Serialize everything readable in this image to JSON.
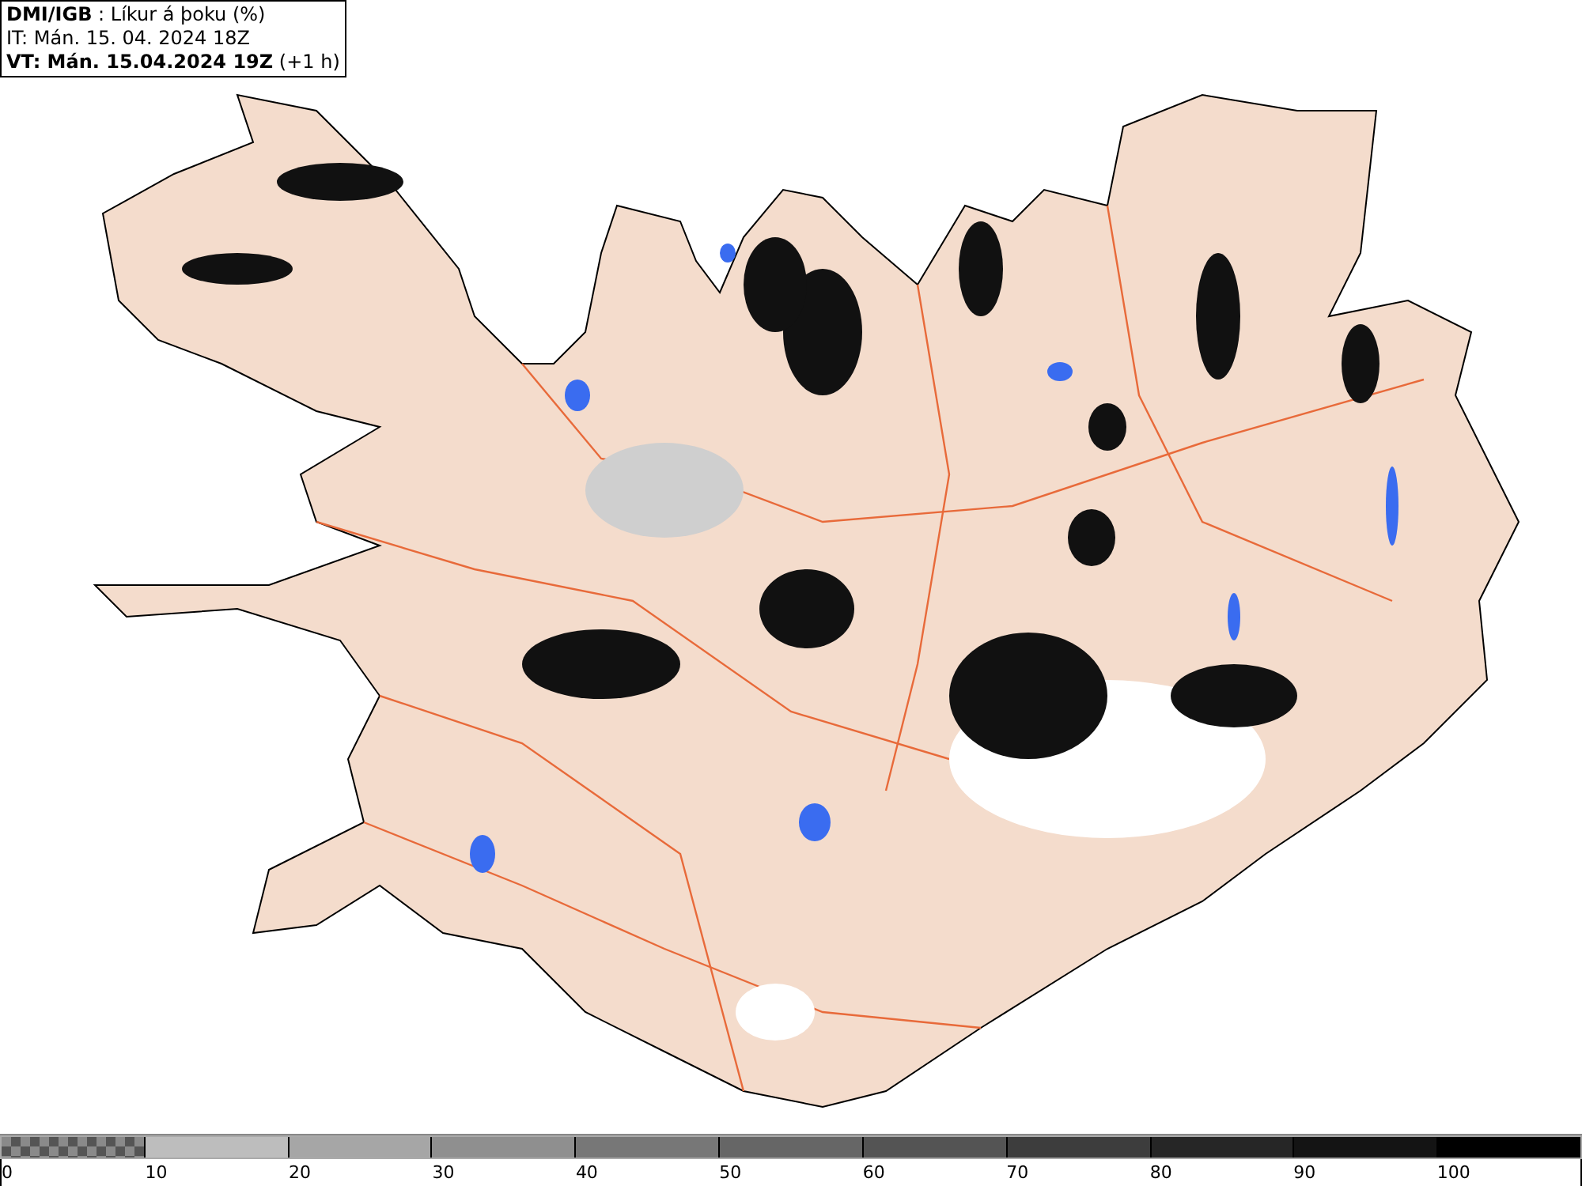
{
  "header": {
    "lines": [
      "**DMI/IGB** : Líkur á þoku (%)",
      "IT: Mán. 15. 04. 2024 18Z",
      "**VT: Mán. 15.04.2024 19Z** (+1 h)"
    ]
  },
  "legend": {
    "segments": [
      {
        "kind": "checker",
        "color": "#8a8a8a"
      },
      {
        "kind": "solid",
        "color": "#bdbdbd"
      },
      {
        "kind": "solid",
        "color": "#a6a6a6"
      },
      {
        "kind": "solid",
        "color": "#8f8f8f"
      },
      {
        "kind": "solid",
        "color": "#777777"
      },
      {
        "kind": "solid",
        "color": "#666666"
      },
      {
        "kind": "solid",
        "color": "#545454"
      },
      {
        "kind": "solid",
        "color": "#3d3d3d"
      },
      {
        "kind": "solid",
        "color": "#262626"
      },
      {
        "kind": "solid",
        "color": "#141414"
      },
      {
        "kind": "solid",
        "color": "#000000"
      }
    ],
    "labels": [
      "0",
      "10",
      "20",
      "30",
      "40",
      "50",
      "60",
      "70",
      "80",
      "90",
      "100"
    ]
  }
}
